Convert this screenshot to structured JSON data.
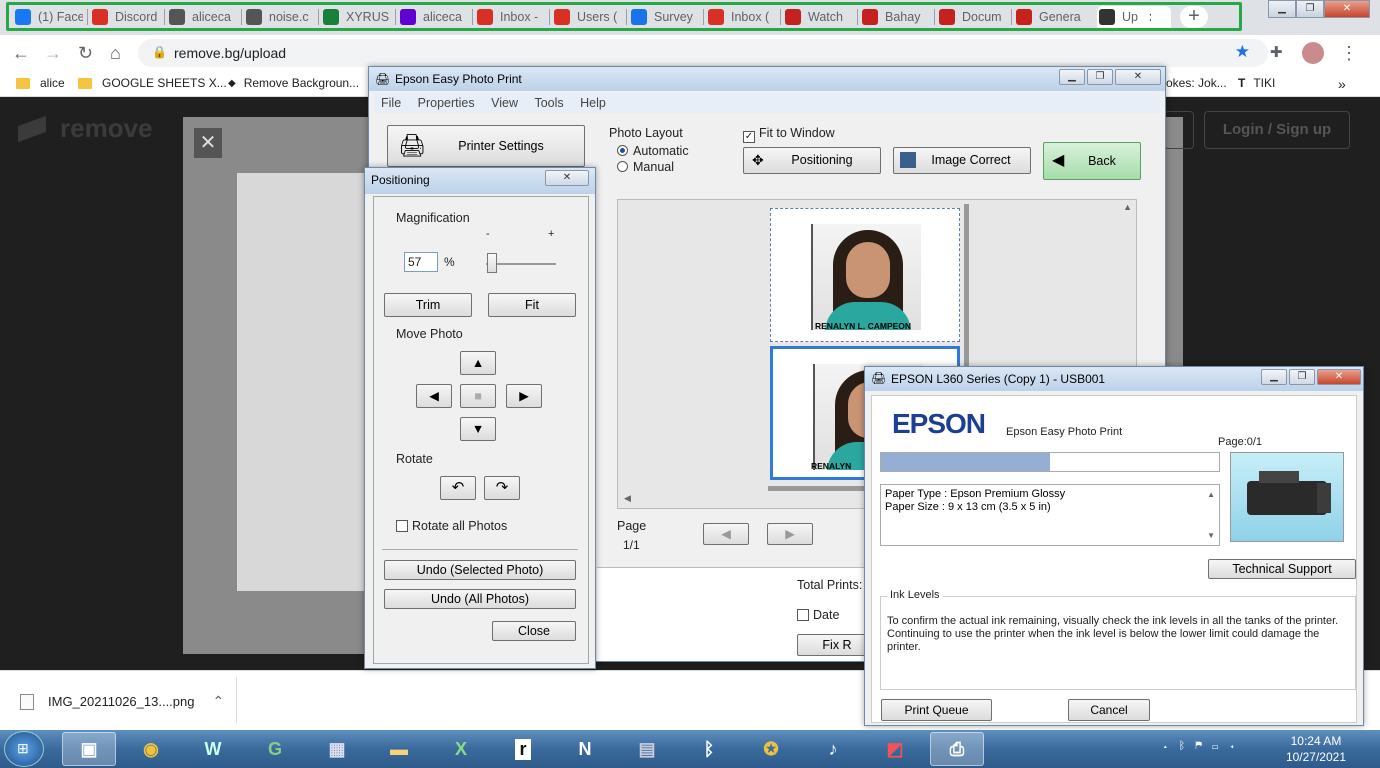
{
  "browser": {
    "tabs": [
      {
        "label": "(1) Face",
        "icon": "facebook-icon",
        "color": "#1877f2"
      },
      {
        "label": "Discord",
        "icon": "discord-icon",
        "color": "#d93025"
      },
      {
        "label": "aliceca",
        "icon": "notion-icon",
        "color": "#555555"
      },
      {
        "label": "noise.c",
        "icon": "notion-icon",
        "color": "#555555"
      },
      {
        "label": "XYRUS",
        "icon": "sheets-icon",
        "color": "#188038"
      },
      {
        "label": "aliceca",
        "icon": "yahoo-mail-icon",
        "color": "#6001d2"
      },
      {
        "label": "Inbox -",
        "icon": "gmail-icon",
        "color": "#d93025"
      },
      {
        "label": "Users (",
        "icon": "gmail-icon",
        "color": "#d93025"
      },
      {
        "label": "Survey",
        "icon": "timer-icon",
        "color": "#1a73e8"
      },
      {
        "label": "Inbox (",
        "icon": "gmail-icon",
        "color": "#d93025"
      },
      {
        "label": "Watch",
        "icon": "pdf-icon",
        "color": "#c5221f"
      },
      {
        "label": "Bahay",
        "icon": "pdf-icon",
        "color": "#c5221f"
      },
      {
        "label": "Docum",
        "icon": "pdf-icon",
        "color": "#c5221f"
      },
      {
        "label": "Genera",
        "icon": "pdf-icon",
        "color": "#c5221f"
      },
      {
        "label": "Up",
        "icon": "removebg-icon",
        "color": "#333333"
      }
    ],
    "new_tab": "+",
    "url": "remove.bg/upload",
    "bookmarks": [
      {
        "label": "alice",
        "icon": "folder-icon"
      },
      {
        "label": "GOOGLE SHEETS X...",
        "icon": "folder-icon"
      },
      {
        "label": "Remove Backgroun...",
        "icon": "removebg-icon"
      },
      {
        "label": "okes: Jok...",
        "icon": "link-icon"
      },
      {
        "label": "TIKI",
        "icon": "tiki-icon"
      }
    ],
    "more": "»"
  },
  "removebg": {
    "logo": "remove",
    "login": "Login / Sign up",
    "close": "✕"
  },
  "downloads": {
    "file": "IMG_20211026_13....png"
  },
  "epson_main": {
    "title": "Epson Easy Photo Print",
    "menu": [
      "File",
      "Properties",
      "View",
      "Tools",
      "Help"
    ],
    "printer_settings": "Printer Settings",
    "photo_layout": "Photo Layout",
    "automatic": "Automatic",
    "manual": "Manual",
    "fit_to_window": "Fit to Window",
    "positioning": "Positioning",
    "image_correct": "Image Correct",
    "back": "Back",
    "photo_name": "RENALYN L. CAMPEON",
    "photo_name_short": "RENALYN",
    "page_label": "Page",
    "page_value": "1/1",
    "total_prints": "Total Prints:",
    "date": "Date",
    "fix": "Fix R"
  },
  "positioning": {
    "title": "Positioning",
    "magnification": "Magnification",
    "minus": "-",
    "plus": "+",
    "value": "57",
    "percent": "%",
    "trim": "Trim",
    "fit": "Fit",
    "move_photo": "Move Photo",
    "rotate": "Rotate",
    "rotate_all": "Rotate all Photos",
    "undo_selected": "Undo (Selected Photo)",
    "undo_all": "Undo (All Photos)",
    "close": "Close"
  },
  "printer": {
    "title": "EPSON L360 Series (Copy 1) - USB001",
    "brand": "EPSON",
    "app": "Epson Easy Photo Print",
    "page": "Page:0/1",
    "progress": 0.5,
    "paper_type": "Paper Type : Epson Premium Glossy",
    "paper_size": "Paper Size : 9 x 13 cm (3.5 x 5 in)",
    "tech_support": "Technical Support",
    "ink_levels": "Ink Levels",
    "ink_text": "To confirm the actual ink remaining, visually check the ink levels in all the tanks of the printer. Continuing to use the printer when the ink level is below the lower limit could damage the printer.",
    "print_queue": "Print Queue",
    "cancel": "Cancel"
  },
  "taskbar": {
    "time": "10:24 AM",
    "date": "10/27/2021"
  }
}
